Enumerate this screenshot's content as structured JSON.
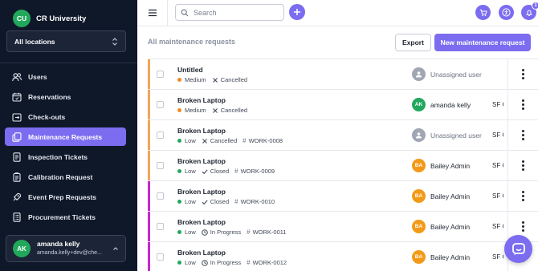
{
  "brand": {
    "initials": "CU",
    "name": "CR University"
  },
  "location_select": {
    "value": "All locations"
  },
  "nav": [
    {
      "label": "Users",
      "icon": "users-icon",
      "active": false
    },
    {
      "label": "Reservations",
      "icon": "calendar-icon",
      "active": false
    },
    {
      "label": "Check-outs",
      "icon": "checkout-icon",
      "active": false
    },
    {
      "label": "Maintenance Requests",
      "icon": "copy-icon",
      "active": true
    },
    {
      "label": "Inspection Tickets",
      "icon": "ticket-icon",
      "active": false
    },
    {
      "label": "Calibration Request",
      "icon": "clipboard-icon",
      "active": false
    },
    {
      "label": "Event Prep Requests",
      "icon": "rocket-icon",
      "active": false
    },
    {
      "label": "Procurement Tickets",
      "icon": "list-icon",
      "active": false
    }
  ],
  "user": {
    "initials": "AK",
    "name": "amanda kelly",
    "email": "amanda.kelly+dev@che..."
  },
  "topbar": {
    "search_placeholder": "Search",
    "notification_count": "1"
  },
  "content": {
    "title": "All maintenance requests",
    "export_label": "Export",
    "new_label": "New maintenance request"
  },
  "colors": {
    "accent": "#7b6cf0",
    "sidebar_bg": "#0f1829",
    "bar_orange": "#f5a356",
    "bar_magenta": "#c42ad0",
    "priority_medium": "#f08a24",
    "priority_low": "#22a85c"
  },
  "rows": [
    {
      "title": "Untitled",
      "priority": "Medium",
      "status": "Cancelled",
      "status_icon": "x-icon",
      "work": "",
      "assignee": "Unassigned user",
      "assignee_initials": "",
      "location": "",
      "bar": "orange"
    },
    {
      "title": "Broken Laptop",
      "priority": "Medium",
      "status": "Cancelled",
      "status_icon": "x-icon",
      "work": "",
      "assignee": "amanda kelly",
      "assignee_initials": "AK",
      "location": "SF C",
      "bar": "orange"
    },
    {
      "title": "Broken Laptop",
      "priority": "Low",
      "status": "Cancelled",
      "status_icon": "x-icon",
      "work": "WORK-0008",
      "assignee": "Unassigned user",
      "assignee_initials": "",
      "location": "SF C",
      "bar": "orange"
    },
    {
      "title": "Broken Laptop",
      "priority": "Low",
      "status": "Closed",
      "status_icon": "check-icon",
      "work": "WORK-0009",
      "assignee": "Bailey Admin",
      "assignee_initials": "BA",
      "location": "SF C",
      "bar": "orange"
    },
    {
      "title": "Broken Laptop",
      "priority": "Low",
      "status": "Closed",
      "status_icon": "check-icon",
      "work": "WORK-0010",
      "assignee": "Bailey Admin",
      "assignee_initials": "BA",
      "location": "SF C",
      "bar": "magenta"
    },
    {
      "title": "Broken Laptop",
      "priority": "Low",
      "status": "In Progress",
      "status_icon": "clock-icon",
      "work": "WORK-0011",
      "assignee": "Bailey Admin",
      "assignee_initials": "BA",
      "location": "SF C",
      "bar": "magenta"
    },
    {
      "title": "Broken Laptop",
      "priority": "Low",
      "status": "In Progress",
      "status_icon": "clock-icon",
      "work": "WORK-0012",
      "assignee": "Bailey Admin",
      "assignee_initials": "BA",
      "location": "SF C",
      "bar": "magenta"
    }
  ]
}
